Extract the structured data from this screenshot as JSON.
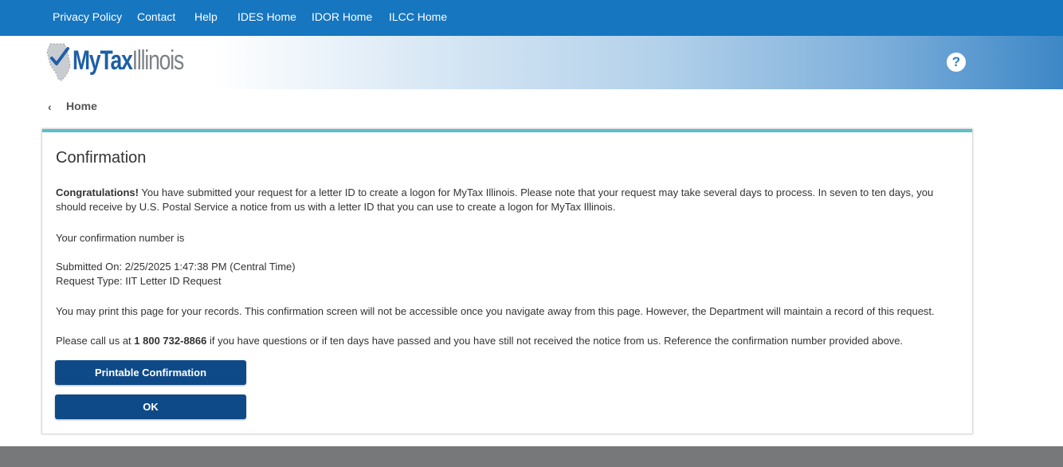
{
  "nav": {
    "items": [
      {
        "label": "Privacy Policy"
      },
      {
        "label": "Contact"
      },
      {
        "label": "Help"
      },
      {
        "label": "IDES Home"
      },
      {
        "label": "IDOR Home"
      },
      {
        "label": "ILCC Home"
      }
    ]
  },
  "header": {
    "logo_my": "MyTax",
    "logo_state": "Illinois",
    "help_icon": "?"
  },
  "breadcrumb": {
    "chevron": "‹",
    "home_label": "Home"
  },
  "confirmation": {
    "title": "Confirmation",
    "congrats_bold": "Congratulations!",
    "congrats_text": " You have submitted your request for a letter ID to create a logon for MyTax Illinois. Please note that your request may take several days to process. In seven to ten days, you should receive by U.S. Postal Service a notice from us with a letter ID that you can use to create a logon for MyTax Illinois.",
    "conf_number_label": "Your confirmation number is",
    "submitted_on": "Submitted On: 2/25/2025 1:47:38 PM (Central Time)",
    "request_type": "Request Type: IIT Letter ID Request",
    "print_note": "You may print this page for your records. This confirmation screen will not be accessible once you navigate away from this page. However, the Department will maintain a record of this request.",
    "call_prefix": "Please call us at ",
    "phone": "1 800 732-8866",
    "call_suffix": " if you have questions or if ten days have passed and you have still not received the notice from us. Reference the confirmation number provided above.",
    "print_button": "Printable Confirmation",
    "ok_button": "OK"
  },
  "colors": {
    "nav_bg": "#1676c0",
    "accent_teal": "#5cbfc6",
    "button_bg": "#0e4a88",
    "footer_bg": "#77787a"
  }
}
